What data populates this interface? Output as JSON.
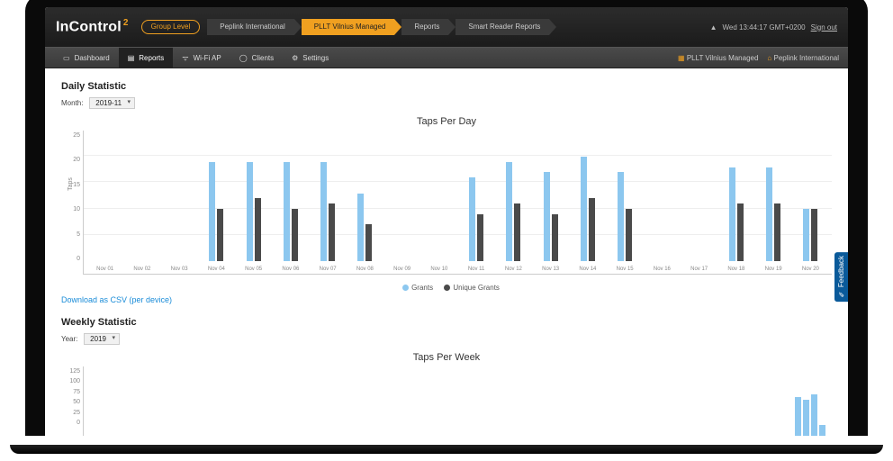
{
  "header": {
    "brand": "InControl",
    "brand_sup": "2",
    "time": "Wed 13:44:17 GMT+0200",
    "signout": "Sign out",
    "crumbs": [
      {
        "label": "Group Level",
        "kind": "pill"
      },
      {
        "label": "Peplink International"
      },
      {
        "label": "PLLT Vilnius Managed",
        "kind": "active"
      },
      {
        "label": "Reports"
      },
      {
        "label": "Smart Reader Reports"
      }
    ]
  },
  "nav": [
    {
      "icon": "▭",
      "label": "Dashboard"
    },
    {
      "icon": "▤",
      "label": "Reports",
      "active": true
    },
    {
      "icon": "ᯤ",
      "label": "Wi-Fi AP"
    },
    {
      "icon": "◯",
      "label": "Clients"
    },
    {
      "icon": "⚙",
      "label": "Settings"
    }
  ],
  "nav_right": [
    {
      "icon": "▦",
      "label": "PLLT Vilnius Managed",
      "color": "#f0a020"
    },
    {
      "icon": "⌂",
      "label": "Peplink International",
      "color": "#f0a020"
    }
  ],
  "daily": {
    "title": "Daily Statistic",
    "month_label": "Month:",
    "month_value": "2019-11",
    "chart_title": "Taps Per Day",
    "download": "Download as CSV (per device)"
  },
  "weekly": {
    "title": "Weekly Statistic",
    "year_label": "Year:",
    "year_value": "2019",
    "chart_title": "Taps Per Week"
  },
  "yticks": [
    "25",
    "20",
    "15",
    "10",
    "5",
    "0"
  ],
  "yticks2": [
    "125",
    "100",
    "75",
    "50",
    "25",
    "0"
  ],
  "ylabel": "Taps",
  "legend": {
    "grants": "Grants",
    "unique": "Unique Grants"
  },
  "feedback": "Feedback",
  "chart_data": [
    {
      "type": "bar",
      "title": "Taps Per Day",
      "ylabel": "Taps",
      "ylim": [
        0,
        25
      ],
      "categories": [
        "Nov 01",
        "Nov 02",
        "Nov 03",
        "Nov 04",
        "Nov 05",
        "Nov 06",
        "Nov 07",
        "Nov 08",
        "Nov 09",
        "Nov 10",
        "Nov 11",
        "Nov 12",
        "Nov 13",
        "Nov 14",
        "Nov 15",
        "Nov 16",
        "Nov 17",
        "Nov 18",
        "Nov 19",
        "Nov 20"
      ],
      "series": [
        {
          "name": "Grants",
          "color": "#8cc7ef",
          "values": [
            0,
            0,
            0,
            19,
            19,
            19,
            19,
            13,
            0,
            0,
            16,
            19,
            17,
            20,
            17,
            0,
            0,
            18,
            18,
            10
          ]
        },
        {
          "name": "Unique Grants",
          "color": "#4a4a4a",
          "values": [
            0,
            0,
            0,
            10,
            12,
            10,
            11,
            7,
            0,
            0,
            9,
            11,
            9,
            12,
            10,
            0,
            0,
            11,
            11,
            10
          ]
        }
      ]
    },
    {
      "type": "bar",
      "title": "Taps Per Week",
      "ylabel": "Taps",
      "ylim": [
        0,
        125
      ],
      "categories": [],
      "series": [
        {
          "name": "Grants",
          "color": "#8cc7ef",
          "values": []
        },
        {
          "name": "Unique Grants",
          "color": "#4a4a4a",
          "values": []
        }
      ]
    }
  ]
}
